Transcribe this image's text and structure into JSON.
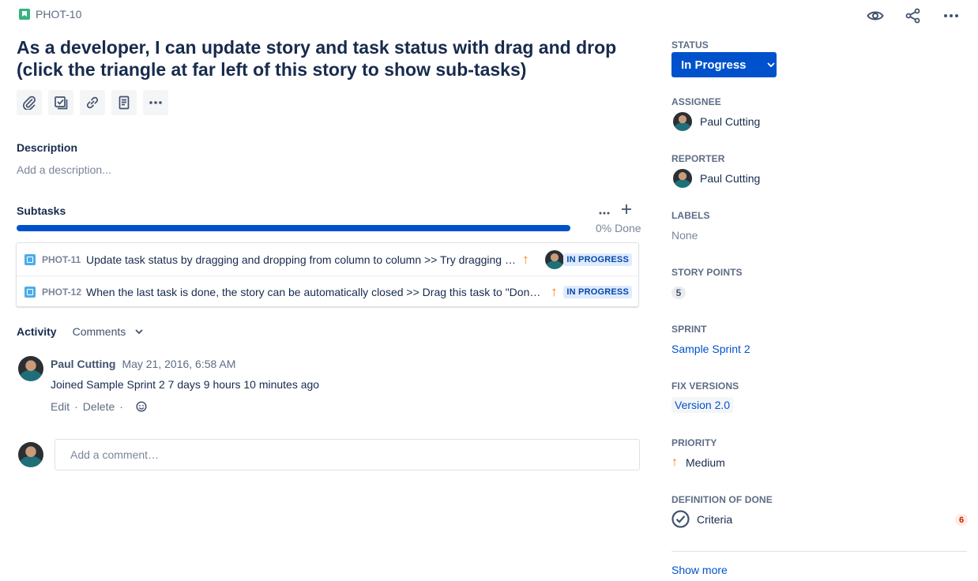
{
  "header": {
    "issue_key": "PHOT-10",
    "issue_type_icon": "story-icon",
    "actions": [
      "watch-icon",
      "share-icon",
      "more-icon"
    ]
  },
  "title": {
    "line1": "As a developer, I can update story and task status with drag and drop",
    "line2": "(click the triangle at far left of this story to show sub-tasks)"
  },
  "toolbar": [
    "attach-icon",
    "add-child-icon",
    "link-icon",
    "page-icon",
    "more-icon"
  ],
  "description": {
    "label": "Description",
    "placeholder": "Add a description..."
  },
  "subtasks": {
    "label": "Subtasks",
    "progress_percent": 0,
    "progress_label": "0% Done",
    "items": [
      {
        "key": "PHOT-11",
        "summary": "Update task status by dragging and dropping from column to column >> Try dragging this task to \"Done\"",
        "priority": "Medium",
        "status": "IN PROGRESS",
        "has_assignee": true
      },
      {
        "key": "PHOT-12",
        "summary": "When the last task is done, the story can be automatically closed >> Drag this task to \"Done\" too",
        "priority": "Medium",
        "status": "IN PROGRESS",
        "has_assignee": false
      }
    ]
  },
  "activity": {
    "label": "Activity",
    "filter": "Comments",
    "entries": [
      {
        "author": "Paul Cutting",
        "date": "May 21, 2016, 6:58 AM",
        "body": "Joined Sample Sprint 2 7 days 9 hours 10 minutes ago",
        "edit_label": "Edit",
        "delete_label": "Delete"
      }
    ],
    "add_comment_placeholder": "Add a comment…"
  },
  "sidebar": {
    "status": {
      "label": "STATUS",
      "value": "In Progress"
    },
    "assignee": {
      "label": "ASSIGNEE",
      "value": "Paul Cutting"
    },
    "reporter": {
      "label": "REPORTER",
      "value": "Paul Cutting"
    },
    "labels": {
      "label": "LABELS",
      "value": "None"
    },
    "story_points": {
      "label": "STORY POINTS",
      "value": "5"
    },
    "sprint": {
      "label": "SPRINT",
      "value": "Sample Sprint 2"
    },
    "fix_versions": {
      "label": "FIX VERSIONS",
      "value": "Version 2.0"
    },
    "priority": {
      "label": "PRIORITY",
      "value": "Medium"
    },
    "definition_of_done": {
      "label": "DEFINITION OF DONE",
      "value": "Criteria",
      "count": "6"
    },
    "show_more": "Show more"
  },
  "colors": {
    "primary": "#0052cc",
    "text": "#172b4d",
    "subtle": "#5e6c84",
    "priority_medium": "#ff7a00",
    "lozenge_bg": "#deebff",
    "lozenge_text": "#0747a6"
  }
}
